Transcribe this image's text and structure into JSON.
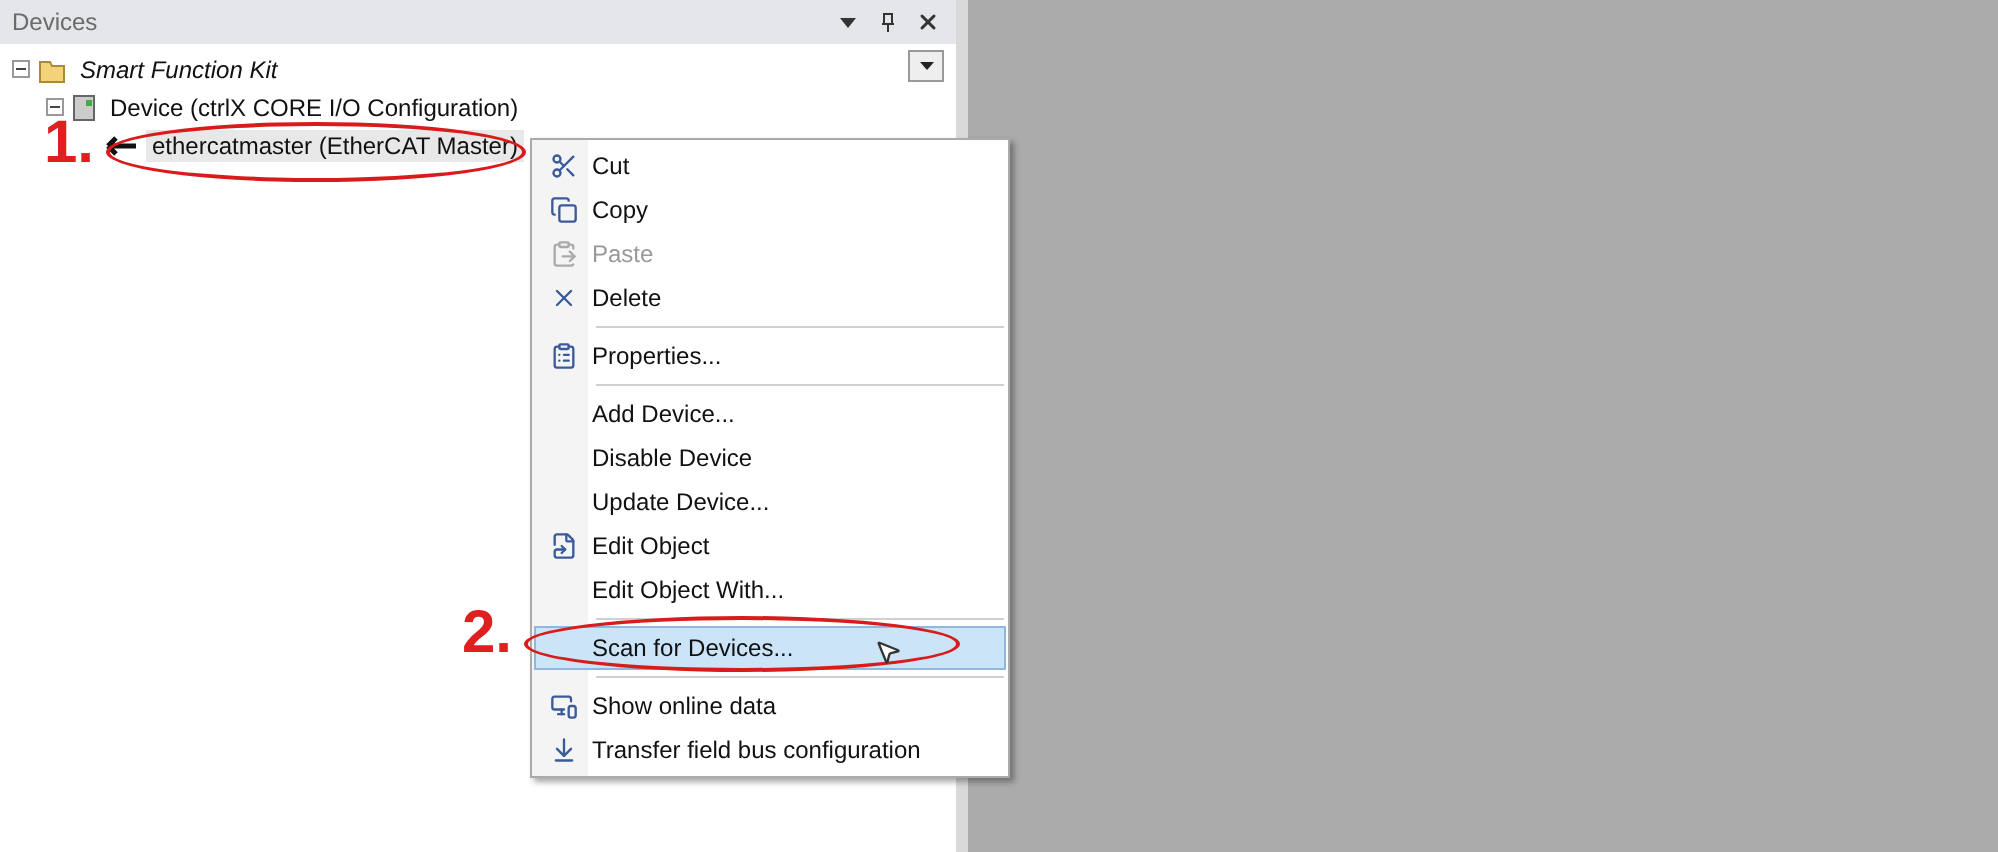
{
  "panel": {
    "title": "Devices"
  },
  "tree": [
    {
      "label": "Smart Function Kit",
      "expanded": true,
      "selected": false,
      "children": [
        {
          "label": "Device (ctrlX CORE I/O Configuration)",
          "expanded": true,
          "selected": false,
          "children": [
            {
              "label": "ethercatmaster (EtherCAT Master)",
              "selected": true
            }
          ]
        }
      ]
    }
  ],
  "context_menu": [
    {
      "kind": "item",
      "label": "Cut",
      "disabled": false,
      "selected": false
    },
    {
      "kind": "item",
      "label": "Copy",
      "disabled": false,
      "selected": false
    },
    {
      "kind": "item",
      "label": "Paste",
      "disabled": true,
      "selected": false
    },
    {
      "kind": "item",
      "label": "Delete",
      "disabled": false,
      "selected": false
    },
    {
      "kind": "separator"
    },
    {
      "kind": "item",
      "label": "Properties...",
      "disabled": false,
      "selected": false
    },
    {
      "kind": "separator"
    },
    {
      "kind": "item",
      "label": "Add Device...",
      "disabled": false,
      "selected": false
    },
    {
      "kind": "item",
      "label": "Disable Device",
      "disabled": false,
      "selected": false
    },
    {
      "kind": "item",
      "label": "Update Device...",
      "disabled": false,
      "selected": false
    },
    {
      "kind": "item",
      "label": "Edit Object",
      "disabled": false,
      "selected": false
    },
    {
      "kind": "item",
      "label": "Edit Object With...",
      "disabled": false,
      "selected": false
    },
    {
      "kind": "separator"
    },
    {
      "kind": "item",
      "label": "Scan for Devices...",
      "disabled": false,
      "selected": true
    },
    {
      "kind": "separator"
    },
    {
      "kind": "item",
      "label": "Show online data",
      "disabled": false,
      "selected": false
    },
    {
      "kind": "item",
      "label": "Transfer field bus configuration",
      "disabled": false,
      "selected": false
    }
  ],
  "annotations": [
    {
      "label": "1."
    },
    {
      "label": "2."
    }
  ]
}
